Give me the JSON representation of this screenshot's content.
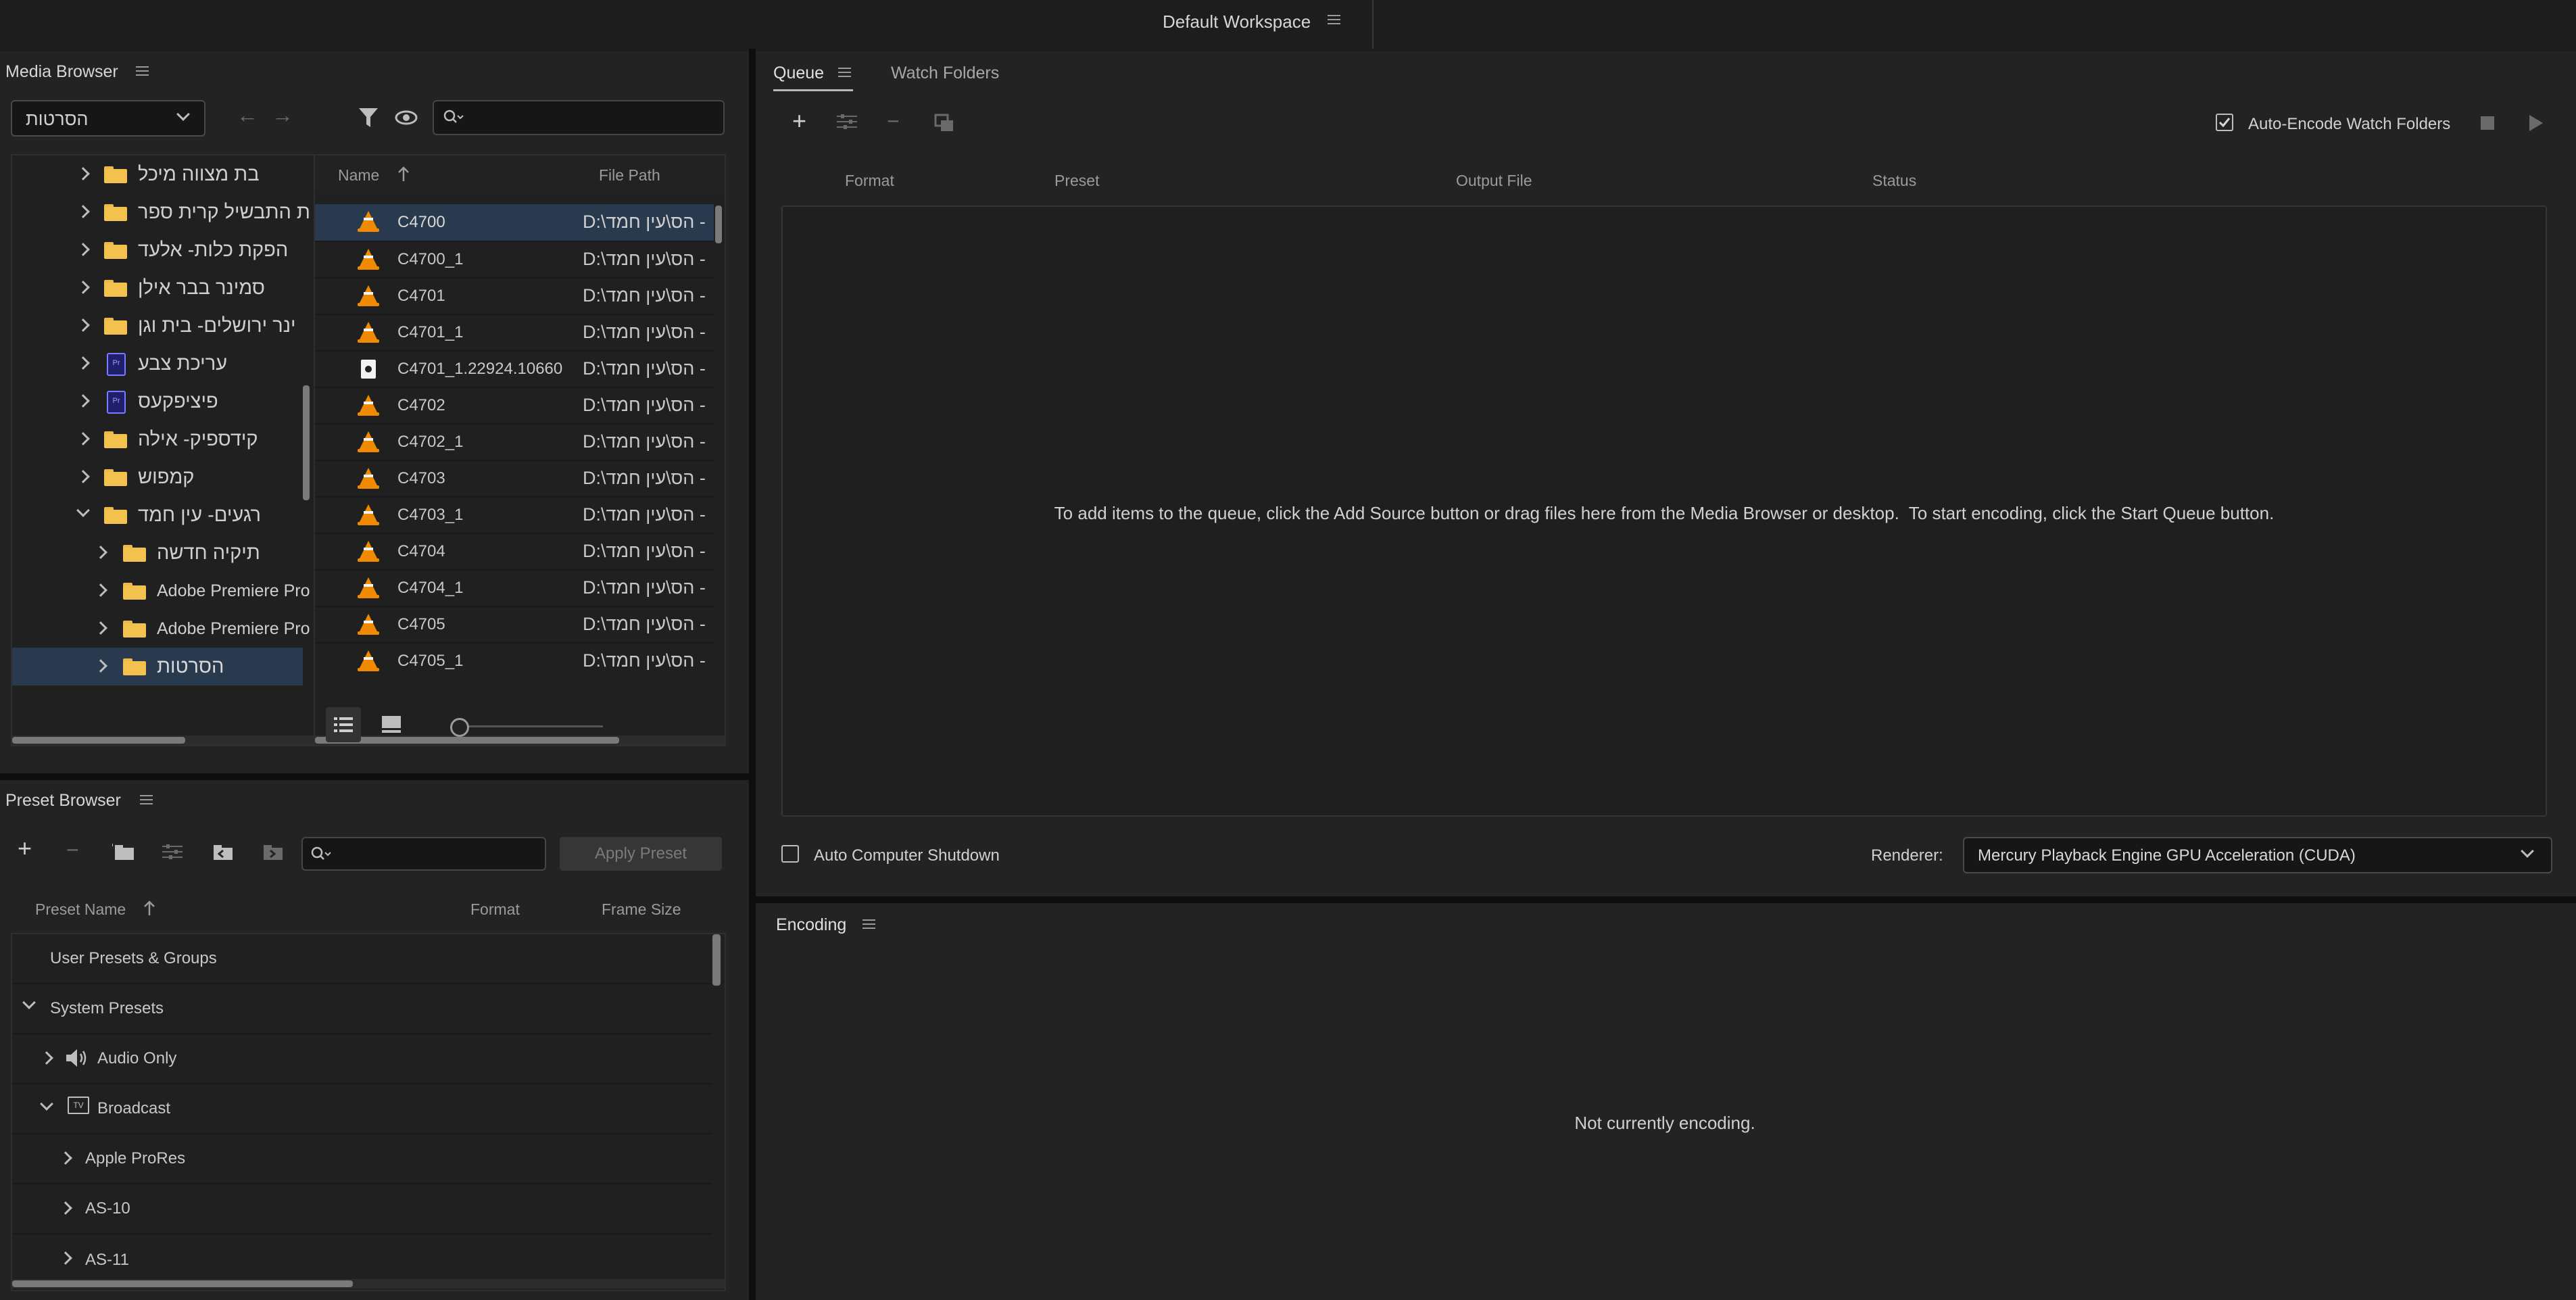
{
  "workspace": {
    "title": "Default Workspace"
  },
  "media_browser": {
    "title": "Media Browser",
    "location_selected": "הסרטות",
    "search_placeholder": "",
    "tree": [
      {
        "label": "בת מצווה מיכל",
        "icon": "folder-icon",
        "indent": 0,
        "expanded": false
      },
      {
        "label": "ת התבשיל קרית ספר",
        "icon": "folder-icon",
        "indent": 0,
        "expanded": false
      },
      {
        "label": "הפקת כלות- אלעד",
        "icon": "folder-icon",
        "indent": 0,
        "expanded": false
      },
      {
        "label": "סמינר בבר אילן",
        "icon": "folder-icon",
        "indent": 0,
        "expanded": false
      },
      {
        "label": "ינר ירושלים- בית וגן",
        "icon": "folder-icon",
        "indent": 0,
        "expanded": false
      },
      {
        "label": "עריכת צבע",
        "icon": "premiere-project-icon",
        "indent": 0,
        "expanded": false
      },
      {
        "label": "פיציפקעס",
        "icon": "premiere-project-icon",
        "indent": 0,
        "expanded": false
      },
      {
        "label": "קידספיק- אילה",
        "icon": "folder-icon",
        "indent": 0,
        "expanded": false
      },
      {
        "label": "קמפוש",
        "icon": "folder-icon",
        "indent": 0,
        "expanded": false
      },
      {
        "label": "רגעים- עין חמד",
        "icon": "folder-icon",
        "indent": 0,
        "expanded": true
      },
      {
        "label": "תיקיה חדשה",
        "icon": "folder-icon",
        "indent": 1,
        "expanded": false
      },
      {
        "label": "Adobe Premiere Pro",
        "icon": "folder-icon",
        "indent": 1,
        "expanded": false
      },
      {
        "label": "Adobe Premiere Pro",
        "icon": "folder-icon",
        "indent": 1,
        "expanded": false
      },
      {
        "label": "הסרטות",
        "icon": "folder-icon",
        "indent": 1,
        "expanded": false,
        "selected": true
      }
    ],
    "columns": {
      "name": "Name",
      "path": "File Path"
    },
    "files": [
      {
        "name": "C4700",
        "path": "D:\\הס\\עין חמד -",
        "icon": "vlc-icon",
        "selected": true
      },
      {
        "name": "C4700_1",
        "path": "D:\\הס\\עין חמד -",
        "icon": "vlc-icon"
      },
      {
        "name": "C4701",
        "path": "D:\\הס\\עין חמד -",
        "icon": "vlc-icon"
      },
      {
        "name": "C4701_1",
        "path": "D:\\הס\\עין חמד -",
        "icon": "vlc-icon"
      },
      {
        "name": "C4701_1.22924.10660",
        "path": "D:\\הס\\עין חמד -",
        "icon": "file-icon"
      },
      {
        "name": "C4702",
        "path": "D:\\הס\\עין חמד -",
        "icon": "vlc-icon"
      },
      {
        "name": "C4702_1",
        "path": "D:\\הס\\עין חמד -",
        "icon": "vlc-icon"
      },
      {
        "name": "C4703",
        "path": "D:\\הס\\עין חמד -",
        "icon": "vlc-icon"
      },
      {
        "name": "C4703_1",
        "path": "D:\\הס\\עין חמד -",
        "icon": "vlc-icon"
      },
      {
        "name": "C4704",
        "path": "D:\\הס\\עין חמד -",
        "icon": "vlc-icon"
      },
      {
        "name": "C4704_1",
        "path": "D:\\הס\\עין חמד -",
        "icon": "vlc-icon"
      },
      {
        "name": "C4705",
        "path": "D:\\הס\\עין חמד -",
        "icon": "vlc-icon"
      },
      {
        "name": "C4705_1",
        "path": "D:\\הס\\עין חמד -",
        "icon": "vlc-icon"
      }
    ]
  },
  "preset_browser": {
    "title": "Preset Browser",
    "apply_label": "Apply Preset",
    "columns": {
      "name": "Preset Name",
      "format": "Format",
      "frame_size": "Frame Size"
    },
    "rows": [
      {
        "label": "User Presets & Groups",
        "indent": 0,
        "chevron": "none",
        "icon": ""
      },
      {
        "label": "System Presets",
        "indent": 0,
        "chevron": "down",
        "icon": ""
      },
      {
        "label": "Audio Only",
        "indent": 1,
        "chevron": "right",
        "icon": "speaker-icon"
      },
      {
        "label": "Broadcast",
        "indent": 1,
        "chevron": "down",
        "icon": "tv-icon"
      },
      {
        "label": "Apple ProRes",
        "indent": 2,
        "chevron": "right",
        "icon": ""
      },
      {
        "label": "AS-10",
        "indent": 2,
        "chevron": "right",
        "icon": ""
      },
      {
        "label": "AS-11",
        "indent": 2,
        "chevron": "right",
        "icon": ""
      }
    ]
  },
  "queue": {
    "tabs": [
      "Queue",
      "Watch Folders"
    ],
    "active_tab": "Queue",
    "auto_encode_label": "Auto-Encode Watch Folders",
    "auto_encode_checked": true,
    "columns": [
      "Format",
      "Preset",
      "Output File",
      "Status"
    ],
    "empty_message": "To add items to the queue, click the Add Source button or drag files here from the Media Browser or desktop.  To start encoding, click the Start Queue button.",
    "auto_shutdown_label": "Auto Computer Shutdown",
    "auto_shutdown_checked": false,
    "renderer_label": "Renderer:",
    "renderer_value": "Mercury Playback Engine GPU Acceleration (CUDA)"
  },
  "encoding": {
    "title": "Encoding",
    "status": "Not currently encoding."
  }
}
